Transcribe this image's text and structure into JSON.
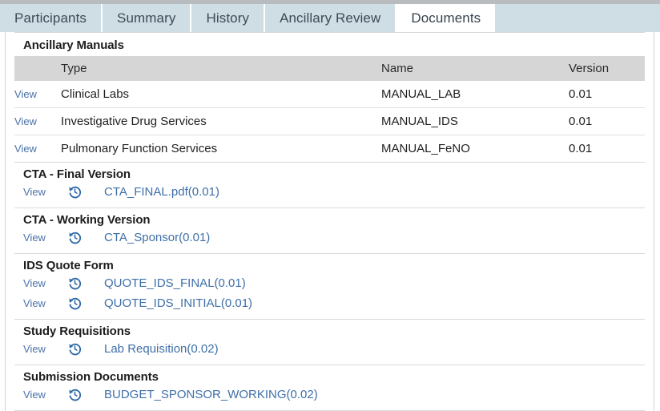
{
  "tabs": [
    {
      "label": "Participants",
      "active": false
    },
    {
      "label": "Summary",
      "active": false
    },
    {
      "label": "History",
      "active": false
    },
    {
      "label": "Ancillary Review",
      "active": false
    },
    {
      "label": "Documents",
      "active": true
    }
  ],
  "colors": {
    "tab_bar_bg": "#cfdde5",
    "tab_active_bg": "#ffffff",
    "table_header_bg": "#d6d6d6",
    "link_blue": "#3e6fa8",
    "view_link_blue": "#4a72a8",
    "divider": "#d7d9db",
    "top_strip": "#b9bcbe"
  },
  "ancillary_manuals": {
    "title": "Ancillary Manuals",
    "columns": [
      "",
      "Type",
      "Name",
      "Version"
    ],
    "rows": [
      {
        "view": "View",
        "type": "Clinical Labs",
        "name": "MANUAL_LAB",
        "version": "0.01"
      },
      {
        "view": "View",
        "type": "Investigative Drug Services",
        "name": "MANUAL_IDS",
        "version": "0.01"
      },
      {
        "view": "View",
        "type": "Pulmonary Function Services",
        "name": "MANUAL_FeNO",
        "version": "0.01"
      }
    ]
  },
  "document_groups": [
    {
      "title": "CTA - Final Version",
      "items": [
        {
          "view": "View",
          "icon": "history-icon",
          "name": "CTA_FINAL.pdf(0.01)"
        }
      ]
    },
    {
      "title": "CTA - Working Version",
      "items": [
        {
          "view": "View",
          "icon": "history-icon",
          "name": "CTA_Sponsor(0.01)"
        }
      ]
    },
    {
      "title": "IDS Quote Form",
      "items": [
        {
          "view": "View",
          "icon": "history-icon",
          "name": "QUOTE_IDS_FINAL(0.01)"
        },
        {
          "view": "View",
          "icon": "history-icon",
          "name": "QUOTE_IDS_INITIAL(0.01)"
        }
      ]
    },
    {
      "title": "Study Requisitions",
      "items": [
        {
          "view": "View",
          "icon": "history-icon",
          "name": "Lab Requisition(0.02)"
        }
      ]
    },
    {
      "title": "Submission Documents",
      "items": [
        {
          "view": "View",
          "icon": "history-icon",
          "name": "BUDGET_SPONSOR_WORKING(0.02)"
        }
      ]
    }
  ]
}
